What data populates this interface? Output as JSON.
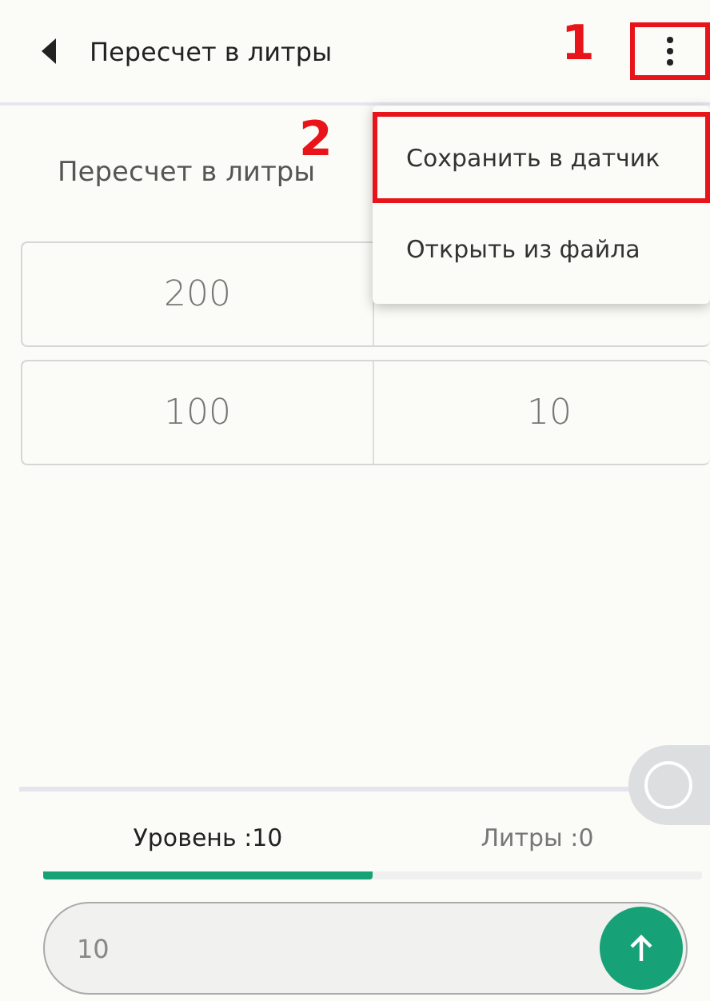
{
  "app_bar": {
    "title": "Пересчет в литры",
    "annotation": "1"
  },
  "menu": {
    "annotation": "2",
    "items": [
      {
        "label": "Сохранить в датчик",
        "highlighted": true
      },
      {
        "label": "Открыть из файла",
        "highlighted": false
      }
    ]
  },
  "section_title": "Пересчет в литры",
  "table": {
    "rows": [
      [
        "200"
      ],
      [
        "100",
        "10"
      ]
    ]
  },
  "tabs": [
    {
      "label": "Уровень :10",
      "selected": true
    },
    {
      "label": "Литры :0",
      "selected": false
    }
  ],
  "input": {
    "value": "10"
  }
}
